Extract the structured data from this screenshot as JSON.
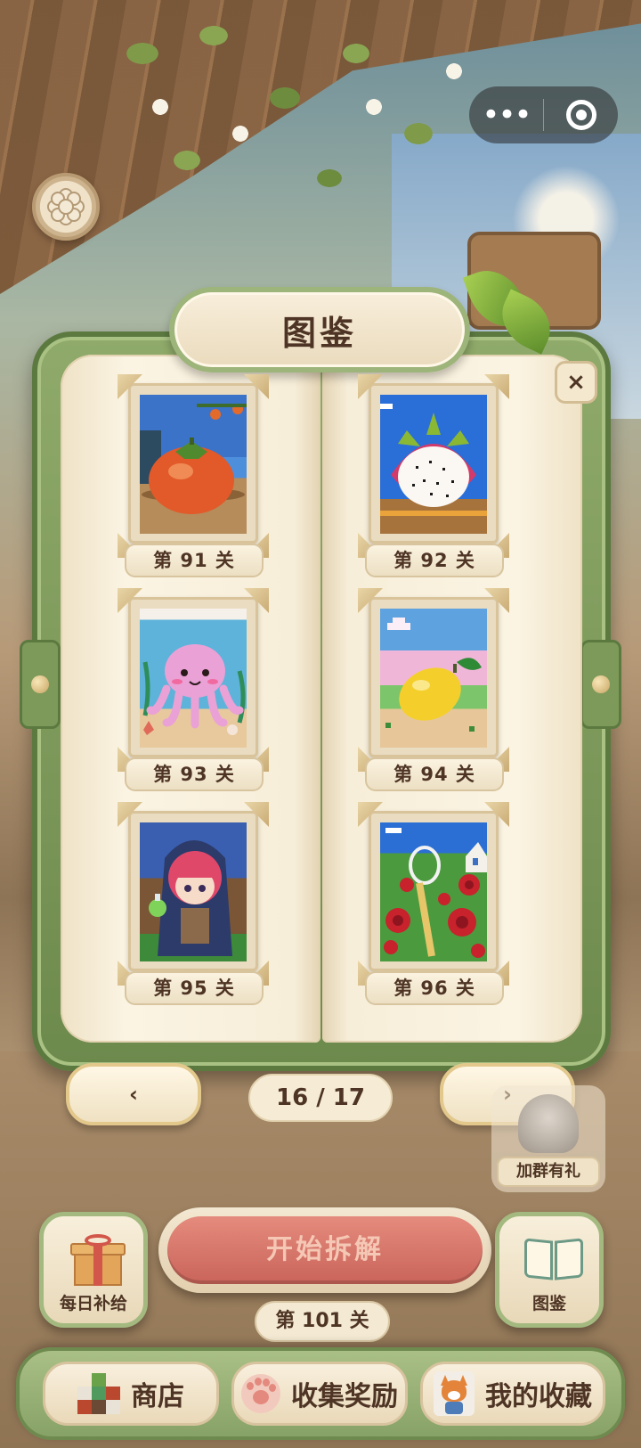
{
  "title": "图鉴",
  "close_label": "×",
  "levels": [
    {
      "label": "第 91 关",
      "subject": "persimmon"
    },
    {
      "label": "第 92 关",
      "subject": "dragon fruit"
    },
    {
      "label": "第 93 关",
      "subject": "octopus"
    },
    {
      "label": "第 94 关",
      "subject": "lemon"
    },
    {
      "label": "第 95 关",
      "subject": "witch girl"
    },
    {
      "label": "第 96 关",
      "subject": "roses"
    }
  ],
  "pagination": {
    "prev": "‹",
    "next": "›",
    "indicator": "16 / 17",
    "current": 16,
    "total": 17
  },
  "group_gift": {
    "label": "加群有礼"
  },
  "daily": {
    "label": "每日补给",
    "icon": "gift-icon"
  },
  "start": {
    "label": "开始拆解"
  },
  "current_level": "第 101 关",
  "codex": {
    "label": "图鉴",
    "icon": "book-icon"
  },
  "tabs": [
    {
      "label": "商店",
      "icon": "blocks-icon"
    },
    {
      "label": "收集奖励",
      "icon": "paw-icon"
    },
    {
      "label": "我的收藏",
      "icon": "fox-icon"
    }
  ],
  "colors": {
    "frame": "#7d9a5a",
    "page": "#fbf4e3",
    "text": "#4e3424",
    "start": "#d9756a"
  }
}
